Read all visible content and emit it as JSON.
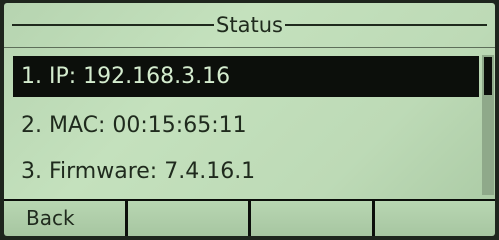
{
  "screen": {
    "title": "Status"
  },
  "menu": {
    "items": [
      {
        "label": "1. IP: 192.168.3.16",
        "selected": true
      },
      {
        "label": "2. MAC: 00:15:65:11",
        "selected": false
      },
      {
        "label": "3. Firmware: 7.4.16.1",
        "selected": false
      }
    ]
  },
  "softkeys": [
    "Back",
    "",
    "",
    ""
  ]
}
